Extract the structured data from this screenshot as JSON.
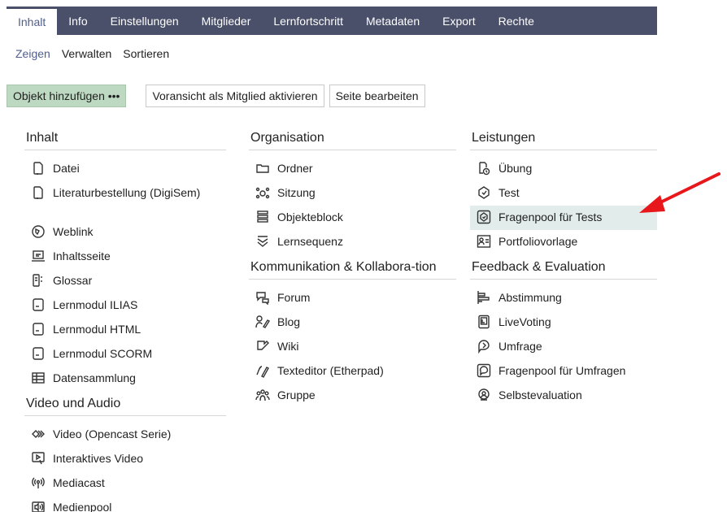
{
  "tabs": [
    "Inhalt",
    "Info",
    "Einstellungen",
    "Mitglieder",
    "Lernfortschritt",
    "Metadaten",
    "Export",
    "Rechte"
  ],
  "subtabs": [
    "Zeigen",
    "Verwalten",
    "Sortieren"
  ],
  "toolbar": {
    "add_label": "Objekt hinzufügen •••",
    "preview_label": "Voransicht als Mitglied aktivieren",
    "edit_label": "Seite bearbeiten"
  },
  "col1": {
    "inhalt_title": "Inhalt",
    "inhalt": [
      "Datei",
      "Literaturbestellung (DigiSem)",
      "Weblink",
      "Inhaltsseite",
      "Glossar",
      "Lernmodul ILIAS",
      "Lernmodul HTML",
      "Lernmodul SCORM",
      "Datensammlung"
    ],
    "video_title": "Video und Audio",
    "video": [
      "Video (Opencast Serie)",
      "Interaktives Video",
      "Mediacast",
      "Medienpool"
    ]
  },
  "col2": {
    "org_title": "Organisation",
    "org": [
      "Ordner",
      "Sitzung",
      "Objekteblock",
      "Lernsequenz"
    ],
    "komm_title": "Kommunikation & Kollabora-tion",
    "komm": [
      "Forum",
      "Blog",
      "Wiki",
      "Texteditor (Etherpad)",
      "Gruppe"
    ]
  },
  "col3": {
    "leist_title": "Leistungen",
    "leist": [
      "Übung",
      "Test",
      "Fragenpool für Tests",
      "Portfoliovorlage"
    ],
    "feed_title": "Feedback & Evaluation",
    "feed": [
      "Abstimmung",
      "LiveVoting",
      "Umfrage",
      "Fragenpool für Umfragen",
      "Selbstevaluation"
    ]
  },
  "colors": {
    "tabbar": "#4a4f6a",
    "accent": "#4f5e8e",
    "primary_button": "#bed9c2",
    "highlight": "#e2ecea",
    "arrow": "#e8171b"
  }
}
